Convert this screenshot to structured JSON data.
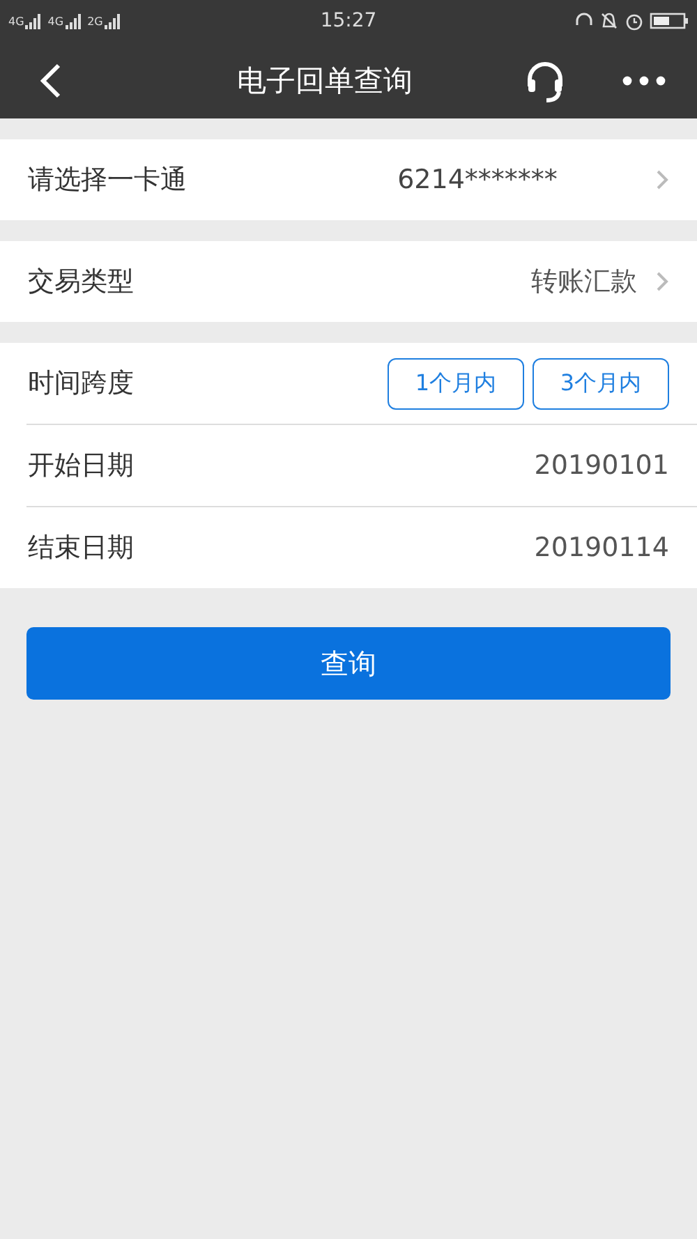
{
  "status_bar": {
    "networks": [
      "4G",
      "4G",
      "2G"
    ],
    "time": "15:27"
  },
  "header": {
    "title": "电子回单查询"
  },
  "card_row": {
    "label": "请选择一卡通",
    "value": "6214*******"
  },
  "type_row": {
    "label": "交易类型",
    "value": "转账汇款"
  },
  "span_row": {
    "label": "时间跨度",
    "options": [
      {
        "label": "1个月内",
        "selected": false
      },
      {
        "label": "3个月内",
        "selected": false
      }
    ]
  },
  "date_rows": [
    {
      "label": "开始日期",
      "value": "20190101"
    },
    {
      "label": "结束日期",
      "value": "20190114"
    }
  ],
  "query_button": "查询"
}
